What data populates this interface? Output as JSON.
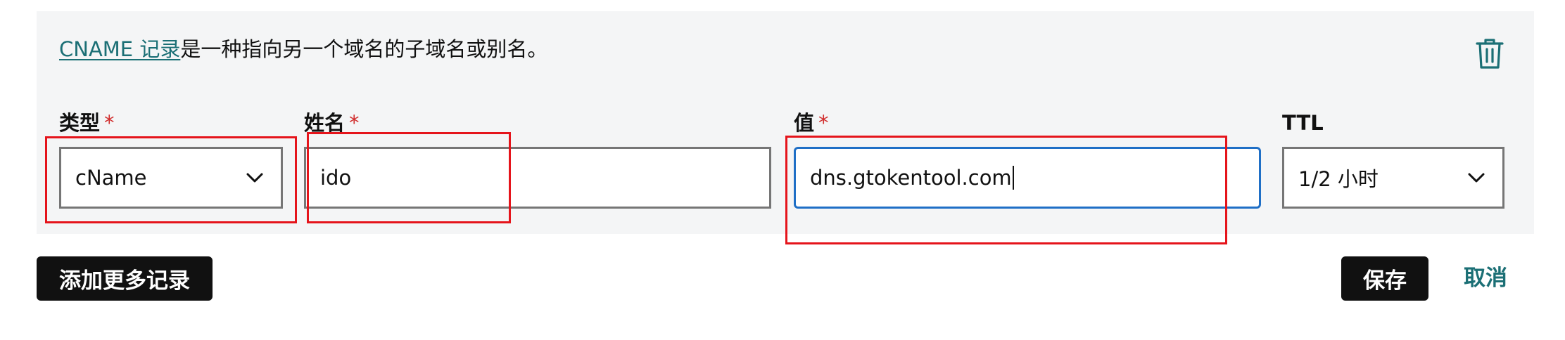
{
  "description": {
    "link_text": "CNAME 记录",
    "rest_text": "是一种指向另一个域名的子域名或别名。"
  },
  "fields": {
    "type": {
      "label": "类型",
      "required_mark": "*",
      "value": "cName"
    },
    "name": {
      "label": "姓名",
      "required_mark": "*",
      "value": "ido"
    },
    "value": {
      "label": "值",
      "required_mark": "*",
      "value": "dns.gtokentool.com"
    },
    "ttl": {
      "label": "TTL",
      "value": "1/2 小时"
    }
  },
  "buttons": {
    "add_more": "添加更多记录",
    "save": "保存",
    "cancel": "取消"
  },
  "icons": {
    "delete": "trash-icon",
    "dropdown": "chevron-down-icon"
  },
  "colors": {
    "accent_teal": "#1b6f75",
    "focus_blue": "#1f6fc6",
    "required_red": "#d12d2d",
    "annotation_red": "#e5141b",
    "button_dark": "#111111",
    "panel_bg": "#f4f5f6"
  }
}
